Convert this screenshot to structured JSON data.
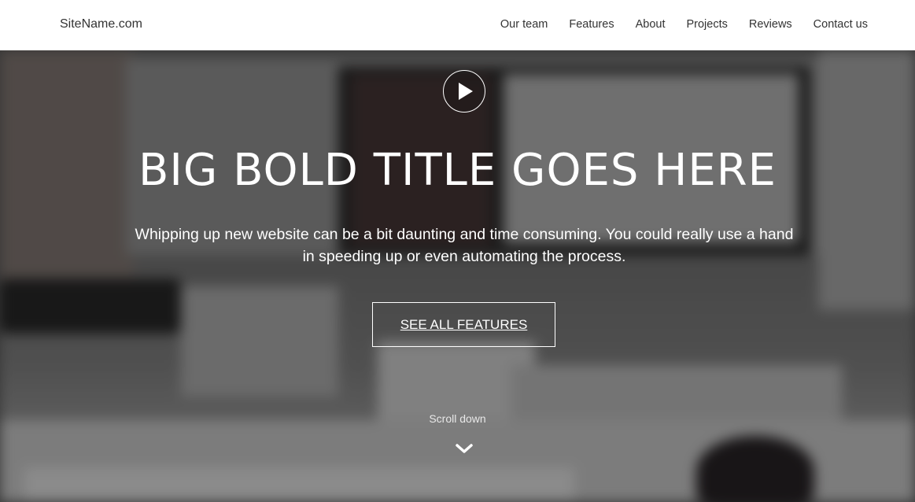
{
  "nav": {
    "brand": "SiteName.com",
    "links": [
      "Our team",
      "Features",
      "About",
      "Projects",
      "Reviews",
      "Contact us"
    ]
  },
  "hero": {
    "title": "BIG BOLD TITLE GOES HERE",
    "subtitle": "Whipping up new website can be a bit daunting and time consuming. You could really use a hand in speeding up or even automating the process.",
    "cta_label": "SEE ALL FEATURES",
    "scroll_label": "Scroll down",
    "play_icon": "play-icon",
    "scroll_icon": "chevron-down-icon"
  },
  "colors": {
    "nav_bg": "#ffffff",
    "nav_text": "#333333",
    "hero_text": "#ffffff",
    "overlay": "rgba(0,0,0,0.42)"
  }
}
